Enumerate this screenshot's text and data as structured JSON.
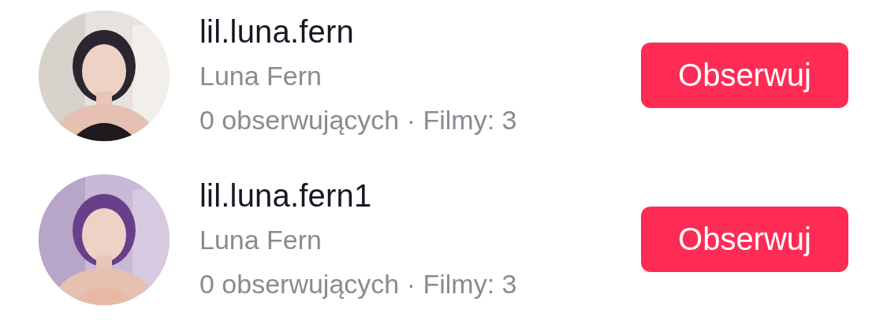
{
  "accounts": [
    {
      "username": "lil.luna.fern",
      "display_name": "Luna Fern",
      "stats": "0 obserwujących · Filmy: 3",
      "button": "Obserwuj"
    },
    {
      "username": "lil.luna.fern1",
      "display_name": "Luna Fern",
      "stats": "0 obserwujących · Filmy: 3",
      "button": "Obserwuj"
    }
  ]
}
